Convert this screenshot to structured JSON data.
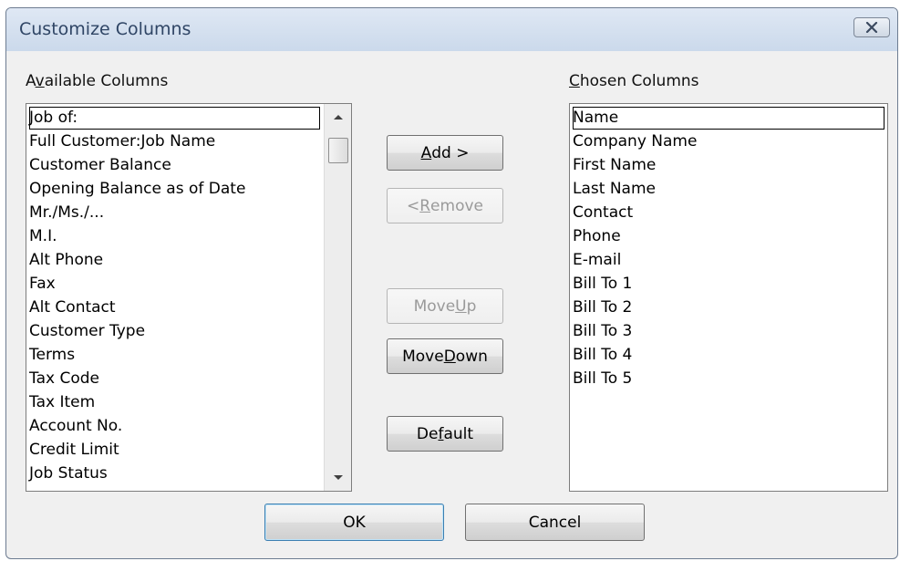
{
  "window": {
    "title": "Customize Columns",
    "close_icon": "close-x-icon"
  },
  "available": {
    "label_pre": "A",
    "label_key": "v",
    "label_post": "ailable Columns",
    "items": [
      "Job of:",
      "Full Customer:Job Name",
      "Customer Balance",
      "Opening Balance as of Date",
      "Mr./Ms./...",
      "M.I.",
      "Alt Phone",
      "Fax",
      "Alt Contact",
      "Customer Type",
      "Terms",
      "Tax Code",
      "Tax Item",
      "Account No.",
      "Credit Limit",
      "Job Status"
    ]
  },
  "chosen": {
    "label_pre": "",
    "label_key": "C",
    "label_post": "hosen Columns",
    "items": [
      "Name",
      "Company Name",
      "First Name",
      "Last Name",
      "Contact",
      "Phone",
      "E-mail",
      "Bill To 1",
      "Bill To 2",
      "Bill To 3",
      "Bill To 4",
      "Bill To 5"
    ]
  },
  "buttons": {
    "add": {
      "pre": "",
      "key": "A",
      "post": "dd >"
    },
    "remove": {
      "pre": "< ",
      "key": "R",
      "post": "emove"
    },
    "move_up": {
      "pre": "Move ",
      "key": "U",
      "post": "p"
    },
    "move_down": {
      "pre": "Move ",
      "key": "D",
      "post": "own"
    },
    "default": {
      "pre": "De",
      "key": "f",
      "post": "ault"
    },
    "ok": "OK",
    "cancel": "Cancel"
  }
}
